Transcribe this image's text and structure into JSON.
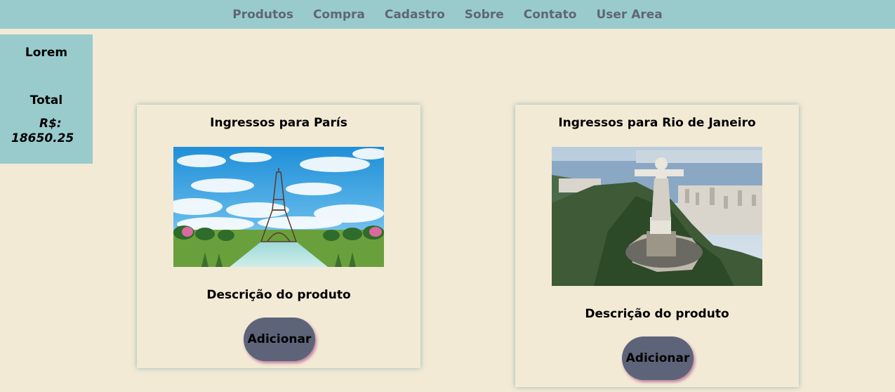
{
  "nav": {
    "items": [
      {
        "label": "Produtos"
      },
      {
        "label": "Compra"
      },
      {
        "label": "Cadastro"
      },
      {
        "label": "Sobre"
      },
      {
        "label": "Contato"
      },
      {
        "label": "User Area"
      }
    ]
  },
  "sidebar": {
    "title": "Lorem",
    "total_label": "Total",
    "currency": "R$:",
    "total_value": "18650.25"
  },
  "products": [
    {
      "title": "Ingressos para París",
      "description": "Descrição do produto",
      "button_label": "Adicionar",
      "image": "paris-eiffel-tower-photo"
    },
    {
      "title": "Ingressos para Rio de Janeiro",
      "description": "Descrição do produto",
      "button_label": "Adicionar",
      "image": "rio-christ-the-redeemer-photo"
    }
  ],
  "colors": {
    "nav_bg": "#99cbcd",
    "nav_text": "#5f6677",
    "page_bg": "#f3ead6",
    "button_bg": "#5d6479"
  }
}
